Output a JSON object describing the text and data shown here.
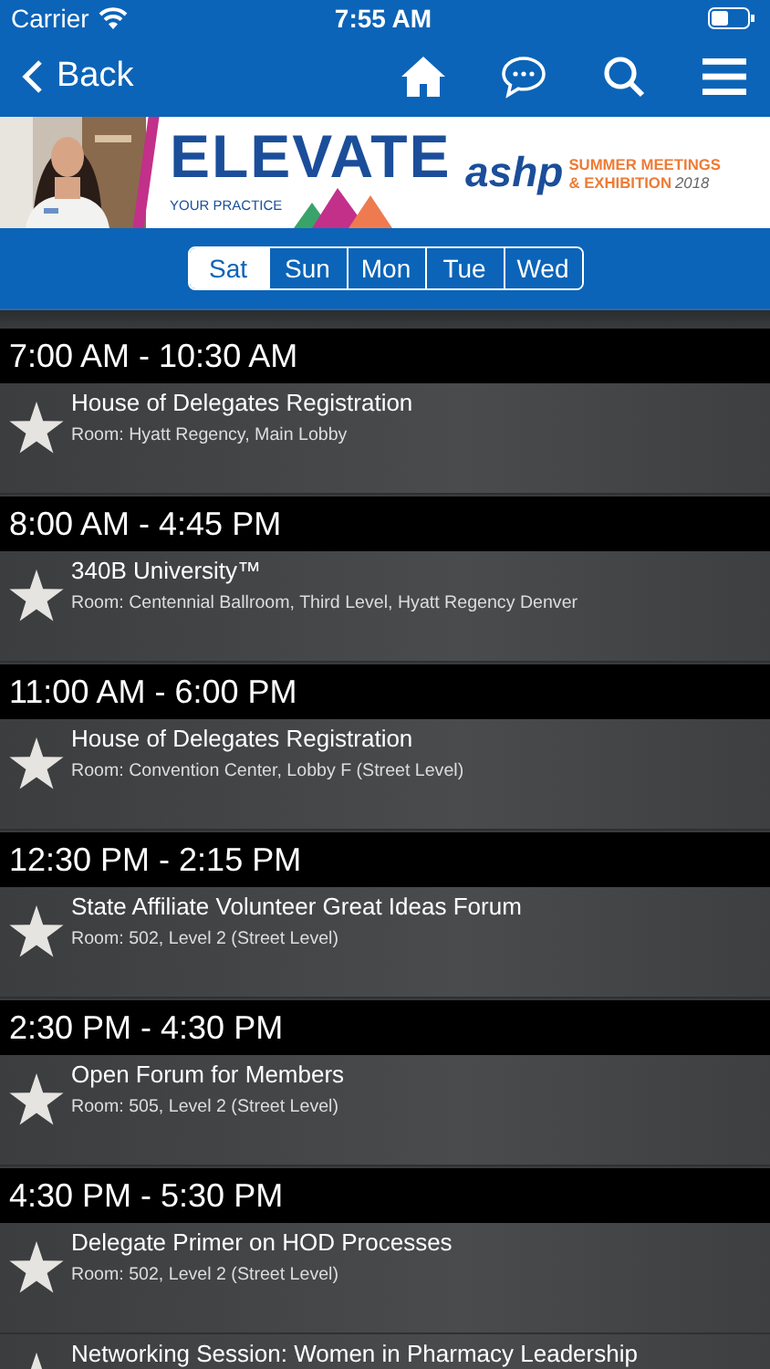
{
  "status_bar": {
    "carrier": "Carrier",
    "time": "7:55 AM"
  },
  "nav": {
    "back": "Back"
  },
  "banner": {
    "headline": "ELEVATE",
    "tagline": "YOUR PRACTICE",
    "logo": "ashp",
    "event_name": "SUMMER MEETINGS",
    "event_sub": "& EXHIBITION",
    "year": "2018"
  },
  "days": [
    {
      "label": "Sat",
      "selected": true
    },
    {
      "label": "Sun",
      "selected": false
    },
    {
      "label": "Mon",
      "selected": false
    },
    {
      "label": "Tue",
      "selected": false
    },
    {
      "label": "Wed",
      "selected": false
    }
  ],
  "schedule": [
    {
      "time": "7:00 AM - 10:30 AM",
      "events": [
        {
          "title": "House of Delegates Registration",
          "room": "Room: Hyatt Regency, Main Lobby"
        }
      ]
    },
    {
      "time": "8:00 AM - 4:45 PM",
      "events": [
        {
          "title": "340B University™",
          "room": "Room: Centennial Ballroom, Third Level, Hyatt Regency Denver"
        }
      ]
    },
    {
      "time": "11:00 AM - 6:00 PM",
      "events": [
        {
          "title": "House of Delegates Registration",
          "room": "Room: Convention Center, Lobby F (Street Level)"
        }
      ]
    },
    {
      "time": "12:30 PM - 2:15 PM",
      "events": [
        {
          "title": "State Affiliate Volunteer Great Ideas Forum",
          "room": "Room: 502, Level 2 (Street Level)"
        }
      ]
    },
    {
      "time": "2:30 PM - 4:30 PM",
      "events": [
        {
          "title": "Open Forum for Members",
          "room": "Room: 505, Level 2 (Street Level)"
        }
      ]
    },
    {
      "time": "4:30 PM - 5:30 PM",
      "events": [
        {
          "title": "Delegate Primer on HOD Processes",
          "room": "Room: 502, Level 2 (Street Level)"
        },
        {
          "title": "Networking Session: Women in Pharmacy Leadership"
        }
      ]
    }
  ]
}
